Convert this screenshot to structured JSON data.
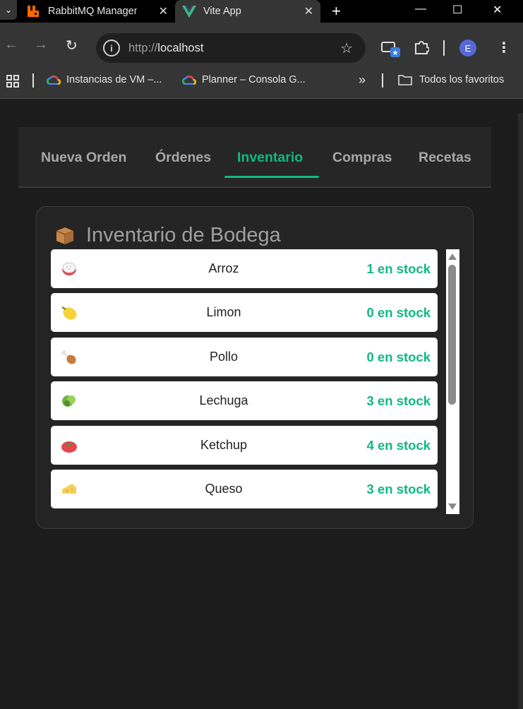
{
  "browser": {
    "tabs": [
      {
        "title": "RabbitMQ Management",
        "active": false
      },
      {
        "title": "Vite App",
        "active": true
      }
    ],
    "url_scheme": "http://",
    "url_host": "localhost",
    "profile_initial": "E",
    "bookmarks": [
      {
        "label": "Instancias de VM –..."
      },
      {
        "label": "Planner – Consola G..."
      }
    ],
    "all_bookmarks_label": "Todos los favoritos",
    "overflow_label": "»"
  },
  "nav": {
    "tabs": [
      {
        "label": "Nueva Orden",
        "active": false
      },
      {
        "label": "Órdenes",
        "active": false
      },
      {
        "label": "Inventario",
        "active": true
      },
      {
        "label": "Compras",
        "active": false
      },
      {
        "label": "Recetas",
        "active": false
      }
    ],
    "accent_color": "#10b981"
  },
  "inventory": {
    "title": "Inventario de Bodega",
    "title_icon": "package-icon",
    "items": [
      {
        "name": "Arroz",
        "stock": "1 en stock",
        "icon": "rice-icon"
      },
      {
        "name": "Limon",
        "stock": "0 en stock",
        "icon": "lemon-icon"
      },
      {
        "name": "Pollo",
        "stock": "0 en stock",
        "icon": "chicken-leg-icon"
      },
      {
        "name": "Lechuga",
        "stock": "3 en stock",
        "icon": "lettuce-icon"
      },
      {
        "name": "Ketchup",
        "stock": "4 en stock",
        "icon": "tomato-icon"
      },
      {
        "name": "Queso",
        "stock": "3 en stock",
        "icon": "cheese-icon"
      }
    ]
  }
}
